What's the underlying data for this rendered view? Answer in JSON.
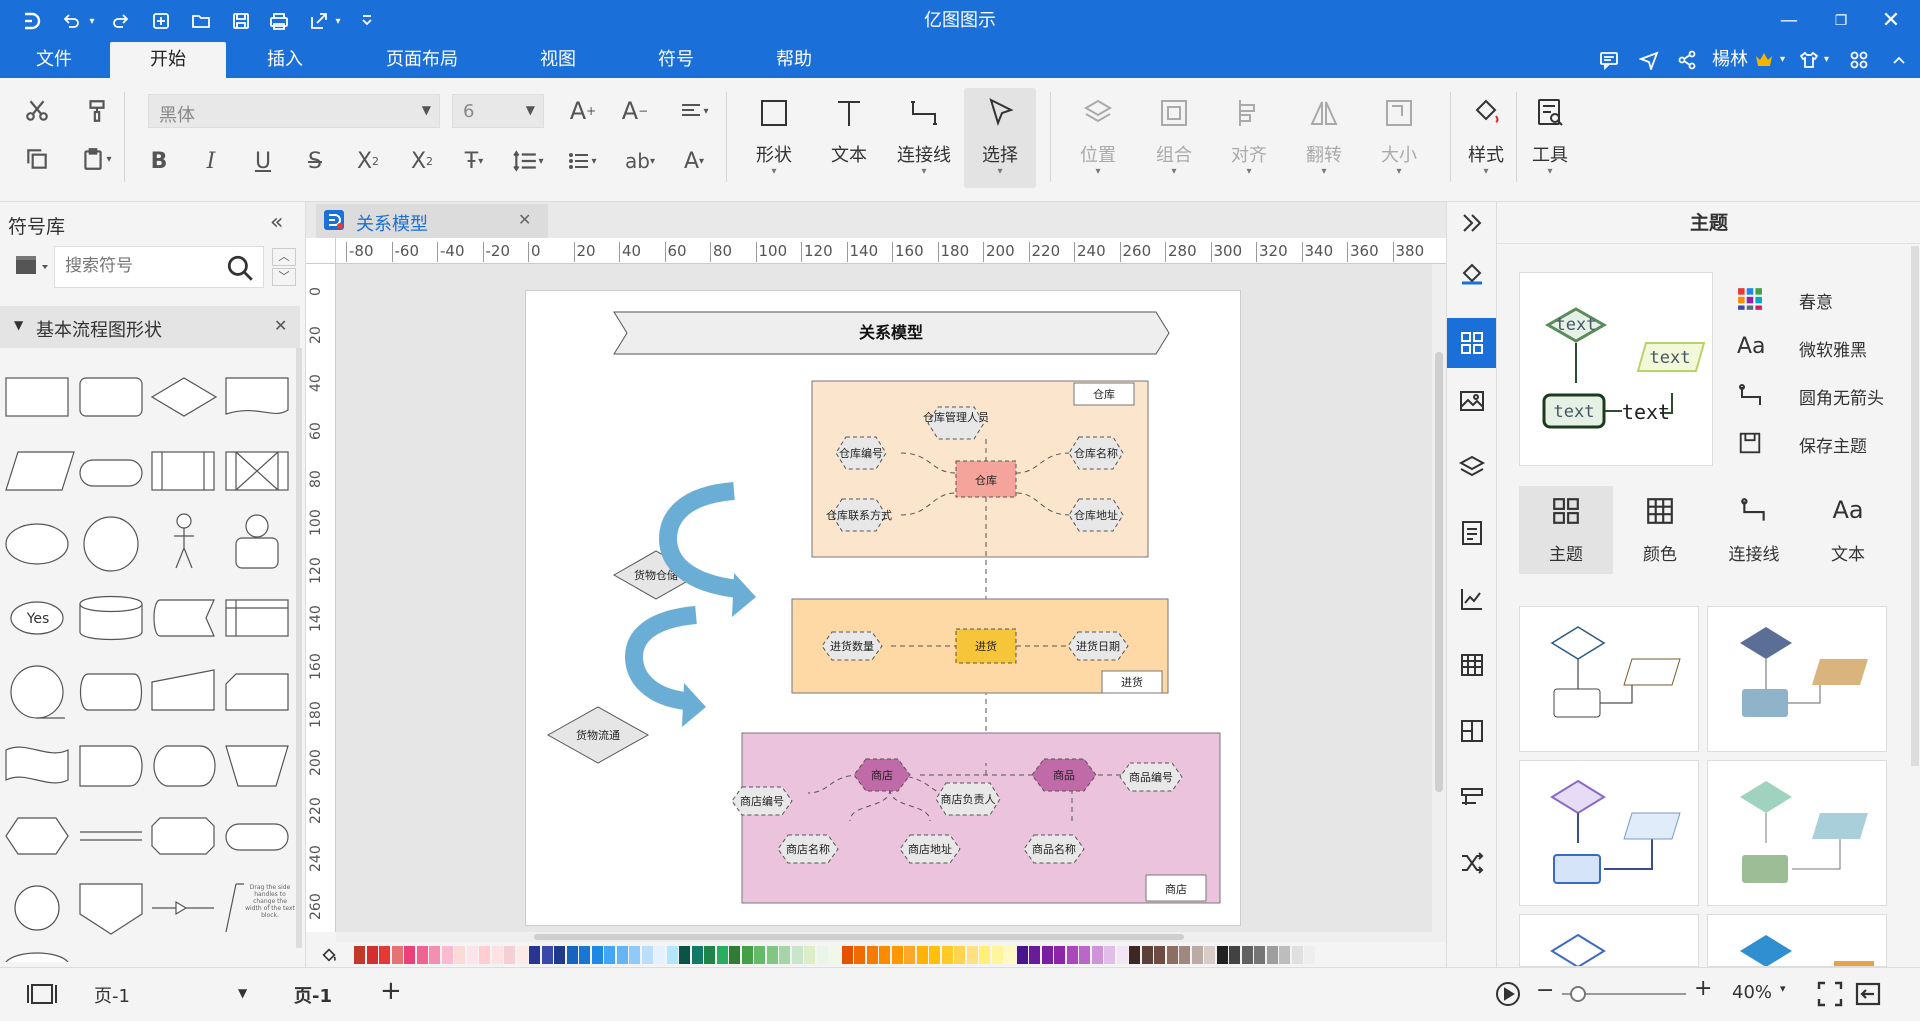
{
  "app": {
    "title": "亿图图示"
  },
  "menu": {
    "items": [
      "文件",
      "开始",
      "插入",
      "页面布局",
      "视图",
      "符号",
      "帮助"
    ],
    "active": "开始"
  },
  "user": {
    "name": "楊林"
  },
  "ribbon": {
    "font_name": "黑体",
    "font_size": "6",
    "big": {
      "shape": "形状",
      "text": "文本",
      "connector": "连接线",
      "select": "选择",
      "position": "位置",
      "group": "组合",
      "align": "对齐",
      "flip": "翻转",
      "size": "大小",
      "style": "样式",
      "tools": "工具"
    }
  },
  "left": {
    "title": "符号库",
    "search_placeholder": "搜索符号",
    "category": "基本流程图形状",
    "yes_label": "Yes",
    "hint": "Drag the side handles to change the width of the text block."
  },
  "doc": {
    "tab": "关系模型"
  },
  "ruler": {
    "h": [
      "-80",
      "-60",
      "-40",
      "-20",
      "0",
      "20",
      "40",
      "60",
      "80",
      "100",
      "120",
      "140",
      "160",
      "180",
      "200",
      "220",
      "240",
      "260",
      "280",
      "300",
      "320",
      "340",
      "360",
      "380"
    ],
    "v": [
      "0",
      "20",
      "40",
      "60",
      "80",
      "100",
      "120",
      "140",
      "160",
      "180",
      "200",
      "220",
      "240",
      "260"
    ]
  },
  "diagram": {
    "title": "关系模型",
    "warehouse": {
      "tag": "仓库",
      "center": "仓库",
      "nodes": [
        "仓库管理人员",
        "仓库编号",
        "仓库名称",
        "仓库联系方式",
        "仓库地址"
      ]
    },
    "purchase": {
      "tag": "进货",
      "center": "进货",
      "nodes": [
        "进货数量",
        "进货日期"
      ]
    },
    "store": {
      "tag": "商店",
      "center1": "商店",
      "center2": "商品",
      "nodes": [
        "商品编号",
        "商店编号",
        "商店负责人",
        "商店名称",
        "商店地址",
        "商品名称"
      ]
    },
    "side": {
      "d1": "货物仓储",
      "d2": "货物流通"
    }
  },
  "palette": {
    "colors": [
      "#c0392b",
      "#d32f2f",
      "#e53935",
      "#e57373",
      "#ec407a",
      "#f06292",
      "#f48fb1",
      "#f8bbd0",
      "#fadbd8",
      "#fce4ec",
      "#ffcdd2",
      "#fde2e4",
      "#f6cfd6",
      "#fbeae5",
      "#283593",
      "#3949ab",
      "#1e3a8a",
      "#1565c0",
      "#1976d2",
      "#1e88e5",
      "#42a5f5",
      "#64b5f6",
      "#90caf9",
      "#bbdefb",
      "#e3f2fd",
      "#b3e5fc",
      "#0b5345",
      "#117a65",
      "#1e8449",
      "#27ae60",
      "#2e7d32",
      "#43a047",
      "#66bb6a",
      "#81c784",
      "#a5d6a7",
      "#c8e6c9",
      "#dcedc8",
      "#e8f5e9",
      "#f1f8e9",
      "#e65100",
      "#ef6c00",
      "#f57c00",
      "#fb8c00",
      "#ff9800",
      "#ffa726",
      "#ffb300",
      "#ffc107",
      "#ffca28",
      "#ffd54f",
      "#ffe082",
      "#fff176",
      "#fff59d",
      "#fff9c4",
      "#4a148c",
      "#6a1b9a",
      "#7b1fa2",
      "#8e24aa",
      "#ab47bc",
      "#ba68c8",
      "#ce93d8",
      "#e1bee7",
      "#f3e5f5",
      "#3e2723",
      "#5d4037",
      "#6d4c41",
      "#8d6e63",
      "#a1887f",
      "#bcaaa4",
      "#d7ccc8",
      "#212121",
      "#424242",
      "#616161",
      "#757575",
      "#9e9e9e",
      "#bdbdbd",
      "#e0e0e0",
      "#eeeeee"
    ]
  },
  "right": {
    "title": "主题",
    "options": [
      "春意",
      "微软雅黑",
      "圆角无箭头",
      "保存主题"
    ],
    "tabs": [
      "主题",
      "颜色",
      "连接线",
      "文本"
    ],
    "preview_text": "text"
  },
  "status": {
    "page_select": "页-1",
    "page_tab": "页-1",
    "zoom": "40%"
  }
}
